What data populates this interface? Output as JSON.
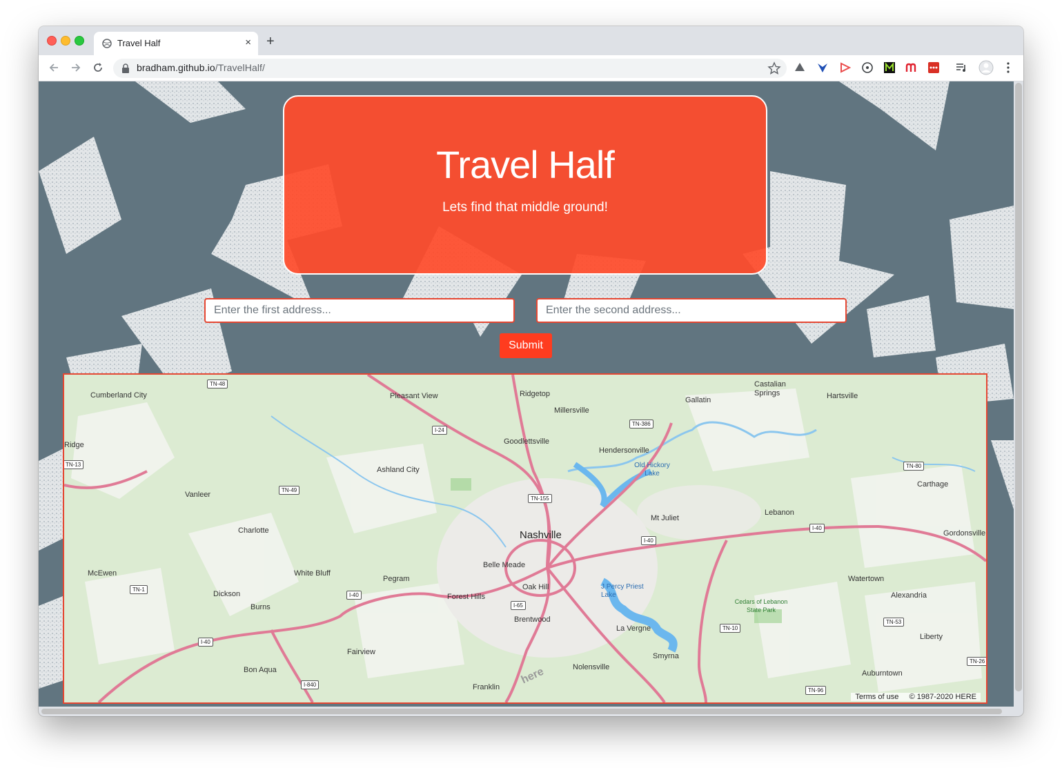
{
  "browser": {
    "tab_title": "Travel Half",
    "close_glyph": "×",
    "new_tab_glyph": "+",
    "url_host": "bradham.github.io",
    "url_path": "/TravelHalf/"
  },
  "hero": {
    "title": "Travel Half",
    "subtitle": "Lets find that middle ground!"
  },
  "form": {
    "first_placeholder": "Enter the first address...",
    "second_placeholder": "Enter the second address...",
    "submit_label": "Submit"
  },
  "map": {
    "cities": [
      "Cumberland City",
      "Pleasant View",
      "Ridgetop",
      "Millersville",
      "Gallatin",
      "Castalian Springs",
      "Hartsville",
      "Ridge",
      "Goodlettsville",
      "Hendersonville",
      "Old Hickory Lake",
      "Ashland City",
      "Vanleer",
      "Carthage",
      "Charlotte",
      "Nashville",
      "Mt Juliet",
      "Lebanon",
      "Gordonsville",
      "Belle Meade",
      "McEwen",
      "White Bluff",
      "Pegram",
      "Oak Hill",
      "J Percy Priest Lake",
      "Watertown",
      "Dickson",
      "Forest Hills",
      "Alexandria",
      "Burns",
      "Brentwood",
      "Cedars of Lebanon State Park",
      "La Vergne",
      "Liberty",
      "Fairview",
      "Smyrna",
      "Nolensville",
      "Bon Aqua",
      "Auburntown",
      "Franklin"
    ],
    "shields": [
      "TN-48",
      "I-24",
      "TN-386",
      "TN-13",
      "TN-80",
      "TN-49",
      "TN-155",
      "I-40",
      "I-40",
      "TN-1",
      "I-40",
      "I-65",
      "TN-53",
      "TN-10",
      "I-40",
      "I-840",
      "TN-26",
      "TN-96"
    ],
    "terms": "Terms of use",
    "copyright": "© 1987-2020 HERE",
    "watermark": "here"
  },
  "colors": {
    "accent": "#ff3c1f",
    "hero_bg": "#ff4b2b",
    "map_border": "#e54732",
    "highway": "#e0738f"
  }
}
